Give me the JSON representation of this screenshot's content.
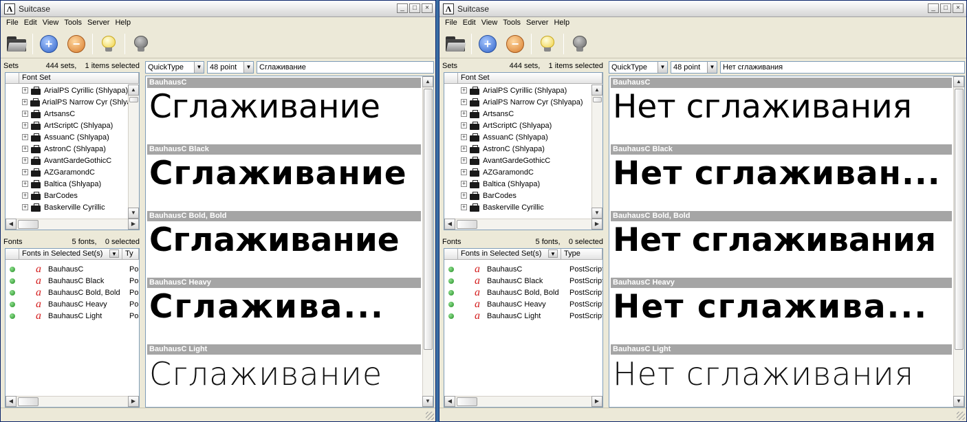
{
  "windows": [
    {
      "title": "Suitcase",
      "menu": [
        "File",
        "Edit",
        "View",
        "Tools",
        "Server",
        "Help"
      ],
      "sets": {
        "label": "Sets",
        "count": "444 sets,",
        "selected": "1 items selected",
        "column": "Font Set"
      },
      "set_items": [
        "ArialPS Cyrillic (Shlyapa)",
        "ArialPS Narrow Cyr (Shlyapa)",
        "ArtsansC",
        "ArtScriptC (Shlyapa)",
        "AssuanC (Shlyapa)",
        "AstronC (Shlyapa)",
        "AvantGardeGothicC",
        "AZGaramondC",
        "Baltica (Shlyapa)",
        "BarCodes",
        "Baskerville Cyrillic"
      ],
      "fonts": {
        "label": "Fonts",
        "count": "5 fonts,",
        "selected": "0 selected",
        "column": "Fonts in Selected Set(s)",
        "type_column": "Ty"
      },
      "font_items": [
        {
          "name": "BauhausC",
          "type": "Po"
        },
        {
          "name": "BauhausC Black",
          "type": "Po"
        },
        {
          "name": "BauhausC Bold, Bold",
          "type": "Po"
        },
        {
          "name": "BauhausC Heavy",
          "type": "Po"
        },
        {
          "name": "BauhausC Light",
          "type": "Po"
        }
      ],
      "preview_mode": "QuickType",
      "point_size": "48 point",
      "sample_text": "Сглаживание",
      "previews": [
        {
          "font": "BauhausC",
          "sample": "Сглаживание"
        },
        {
          "font": "BauhausC Black",
          "sample": "Сглаживание"
        },
        {
          "font": "BauhausC Bold, Bold",
          "sample": "Сглаживание"
        },
        {
          "font": "BauhausC Heavy",
          "sample": "Сглажива..."
        },
        {
          "font": "BauhausC Light",
          "sample": "Сглаживание"
        }
      ]
    },
    {
      "title": "Suitcase",
      "menu": [
        "File",
        "Edit",
        "View",
        "Tools",
        "Server",
        "Help"
      ],
      "sets": {
        "label": "Sets",
        "count": "444 sets,",
        "selected": "1 items selected",
        "column": "Font Set"
      },
      "set_items": [
        "ArialPS Cyrillic (Shlyapa)",
        "ArialPS Narrow Cyr (Shlyapa)",
        "ArtsansC",
        "ArtScriptC (Shlyapa)",
        "AssuanC (Shlyapa)",
        "AstronC (Shlyapa)",
        "AvantGardeGothicC",
        "AZGaramondC",
        "Baltica (Shlyapa)",
        "BarCodes",
        "Baskerville Cyrillic"
      ],
      "fonts": {
        "label": "Fonts",
        "count": "5 fonts,",
        "selected": "0 selected",
        "column": "Fonts in Selected Set(s)",
        "type_column": "Type"
      },
      "font_items": [
        {
          "name": "BauhausC",
          "type": "PostScript"
        },
        {
          "name": "BauhausC Black",
          "type": "PostScript"
        },
        {
          "name": "BauhausC Bold, Bold",
          "type": "PostScript"
        },
        {
          "name": "BauhausC Heavy",
          "type": "PostScript"
        },
        {
          "name": "BauhausC Light",
          "type": "PostScript"
        }
      ],
      "preview_mode": "QuickType",
      "point_size": "48 point",
      "sample_text": "Нет сглаживания",
      "previews": [
        {
          "font": "BauhausC",
          "sample": "Нет сглаживания"
        },
        {
          "font": "BauhausC Black",
          "sample": "Нет сглаживан..."
        },
        {
          "font": "BauhausC Bold, Bold",
          "sample": "Нет сглаживания"
        },
        {
          "font": "BauhausC Heavy",
          "sample": "Нет сглажива..."
        },
        {
          "font": "BauhausC Light",
          "sample": "Нет сглаживания"
        }
      ]
    }
  ],
  "icons": {
    "font_glyph": "a",
    "collapsed": "+",
    "minimize": "_",
    "maximize": "□",
    "close": "×",
    "up": "▲",
    "down": "▼",
    "left": "◀",
    "right": "▶",
    "add": "+",
    "remove": "−"
  },
  "colors": {
    "accent_blue": "#2f62c8",
    "remove_orange": "#d77a2a",
    "active_green": "#1f8a1f",
    "font_glyph_red": "#d42020",
    "preview_header": "#a5a5a5"
  }
}
